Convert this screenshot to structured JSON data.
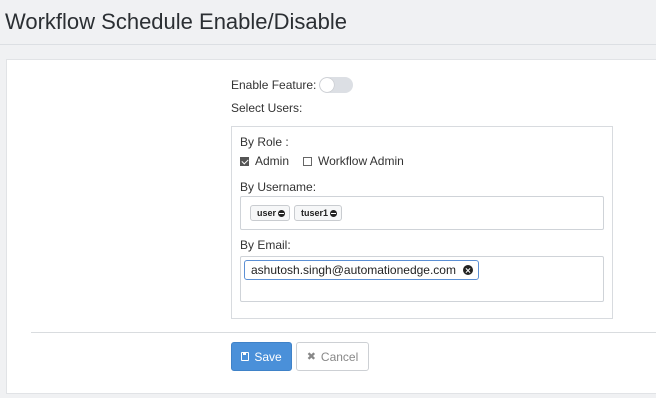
{
  "header": {
    "title": "Workflow Schedule Enable/Disable"
  },
  "form": {
    "enable_feature_label": "Enable Feature:",
    "enable_feature_on": false,
    "select_users_label": "Select Users:",
    "by_role": {
      "label": "By Role :",
      "roles": [
        {
          "label": "Admin",
          "checked": true
        },
        {
          "label": "Workflow Admin",
          "checked": false
        }
      ]
    },
    "by_username": {
      "label": "By Username:",
      "tags": [
        "user",
        "tuser1"
      ]
    },
    "by_email": {
      "label": "By Email:",
      "tags": [
        "ashutosh.singh@automationedge.com"
      ]
    }
  },
  "actions": {
    "save_label": "Save",
    "cancel_label": "Cancel",
    "save_color": "#4a90d9"
  },
  "icons": {
    "save": "floppy-disk-icon",
    "cancel": "x-icon",
    "tag_remove": "minus-circle-icon",
    "email_remove": "x-circle-icon"
  }
}
